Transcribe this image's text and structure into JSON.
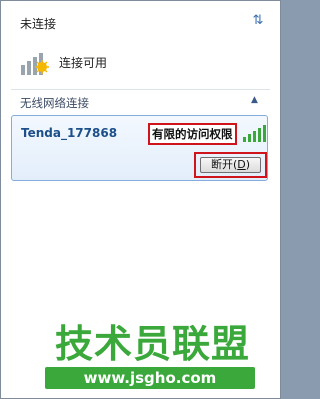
{
  "header": {
    "status_title": "未连接",
    "refresh_icon": "refresh-icon"
  },
  "connection": {
    "label": "连接可用",
    "icon": "wireless-available-icon"
  },
  "section": {
    "title": "无线网络连接",
    "collapse_icon": "chevron-up-icon"
  },
  "network": {
    "ssid": "Tenda_177868",
    "access_status": "有限的访问权限",
    "signal_bars": 5,
    "disconnect_label": "断开(",
    "disconnect_key": "D",
    "disconnect_close": ")"
  },
  "watermark": {
    "brand": "技术员联盟",
    "url": "www.jsgho.com"
  },
  "colors": {
    "highlight_border": "#d0141c",
    "ssid_text": "#1d4f8a",
    "watermark_green": "#3aa83a"
  }
}
